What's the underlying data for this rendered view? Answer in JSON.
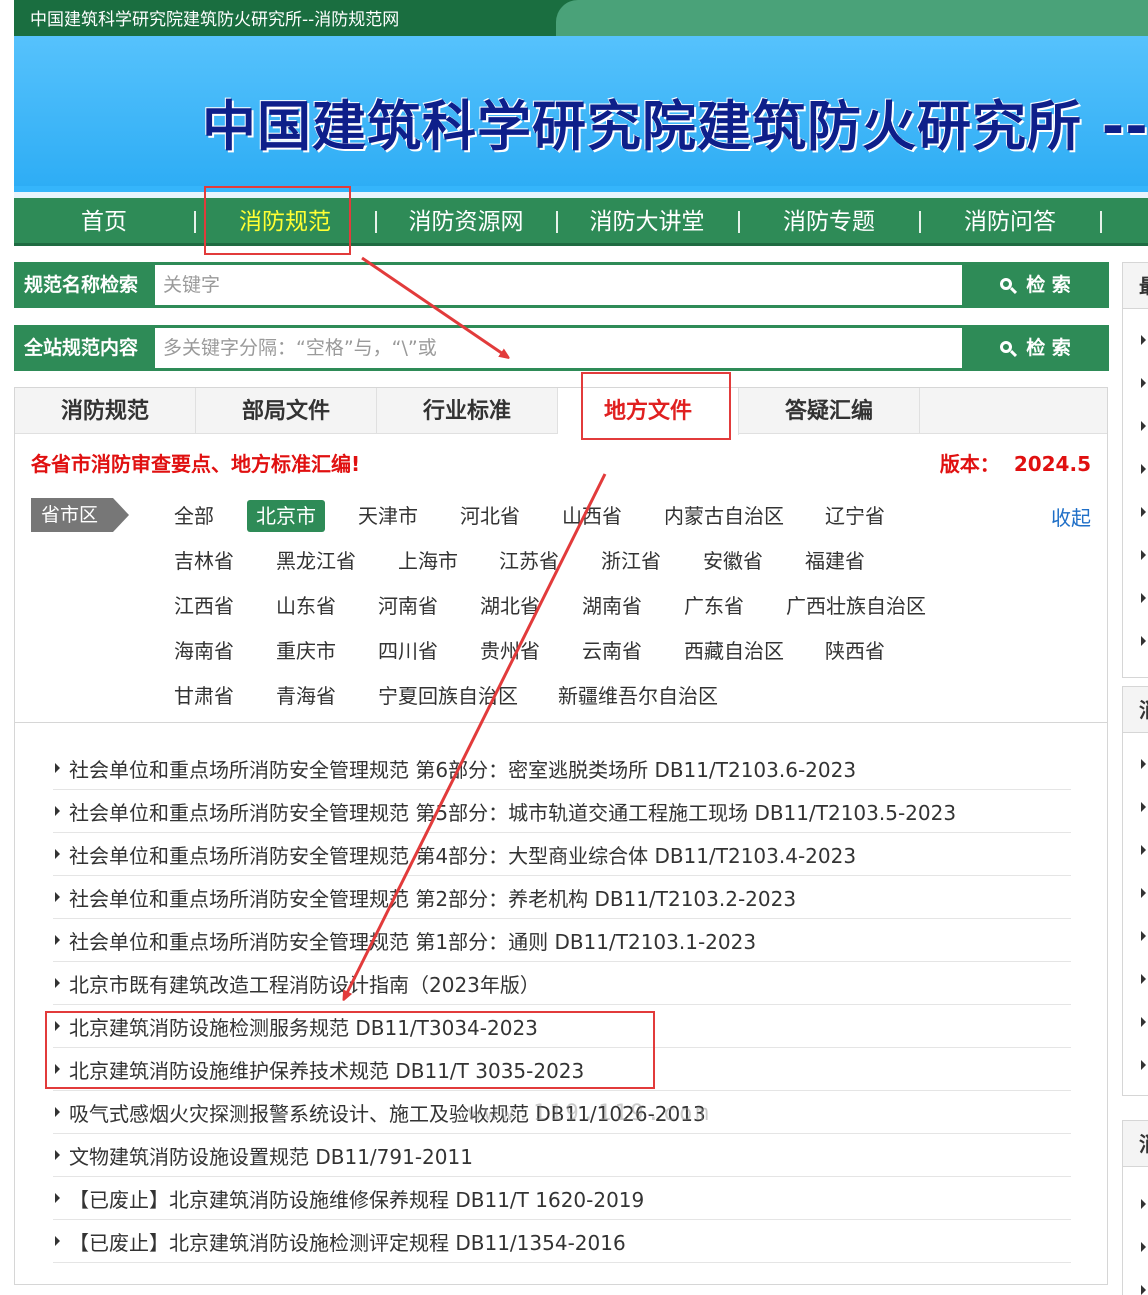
{
  "window": {
    "title": "中国建筑科学研究院建筑防火研究所--消防规范网"
  },
  "banner": {
    "headline": "中国建筑科学研究院建筑防火研究所 --消"
  },
  "nav": {
    "items": [
      "首页",
      "消防规范",
      "消防资源网",
      "消防大讲堂",
      "消防专题",
      "消防问答"
    ]
  },
  "search": {
    "name": {
      "label": "规范名称检索",
      "placeholder": "关键字",
      "button": "检 索"
    },
    "full": {
      "label": "全站规范内容",
      "placeholder": "多关键字分隔：“空格”与，“\\”或",
      "button": "检 索"
    }
  },
  "tabs": [
    "消防规范",
    "部局文件",
    "行业标准",
    "地方文件",
    "答疑汇编"
  ],
  "notice": "各省市消防审查要点、地方标准汇编!",
  "version": {
    "label": "版本：",
    "value": "2024.5"
  },
  "regions": {
    "tag": "省市区",
    "collapse": "收起",
    "rows": [
      [
        "全部",
        "北京市",
        "天津市",
        "河北省",
        "山西省",
        "内蒙古自治区",
        "辽宁省"
      ],
      [
        "吉林省",
        "黑龙江省",
        "上海市",
        "江苏省",
        "浙江省",
        "安徽省",
        "福建省"
      ],
      [
        "江西省",
        "山东省",
        "河南省",
        "湖北省",
        "湖南省",
        "广东省",
        "广西壮族自治区"
      ],
      [
        "海南省",
        "重庆市",
        "四川省",
        "贵州省",
        "云南省",
        "西藏自治区",
        "陕西省"
      ],
      [
        "甘肃省",
        "青海省",
        "宁夏回族自治区",
        "新疆维吾尔自治区"
      ]
    ],
    "active": "北京市"
  },
  "documents": [
    "社会单位和重点场所消防安全管理规范 第6部分：密室逃脱类场所 DB11/T2103.6-2023",
    "社会单位和重点场所消防安全管理规范 第5部分：城市轨道交通工程施工现场 DB11/T2103.5-2023",
    "社会单位和重点场所消防安全管理规范 第4部分：大型商业综合体 DB11/T2103.4-2023",
    "社会单位和重点场所消防安全管理规范 第2部分：养老机构 DB11/T2103.2-2023",
    "社会单位和重点场所消防安全管理规范 第1部分：通则 DB11/T2103.1-2023",
    "北京市既有建筑改造工程消防设计指南（2023年版）",
    "北京建筑消防设施检测服务规范 DB11/T3034-2023",
    "北京建筑消防设施维护保养技术规范 DB11/T 3035-2023",
    "吸气式感烟火灾探测报警系统设计、施工及验收规范 DB11/1026-2013",
    "文物建筑消防设施设置规范 DB11/791-2011",
    "【已废止】北京建筑消防设施维修保养规程 DB11/T 1620-2019",
    "【已废止】北京建筑消防设施检测评定规程 DB11/1354-2016"
  ],
  "watermark": "www.119.119.com",
  "sidebar": {
    "heads": [
      "最",
      "消",
      "消"
    ]
  },
  "colors": {
    "brand_green": "#2e8b57",
    "accent_red": "#e02020",
    "highlight_yellow": "#ffff33",
    "annotation_red": "#e23b3b"
  }
}
